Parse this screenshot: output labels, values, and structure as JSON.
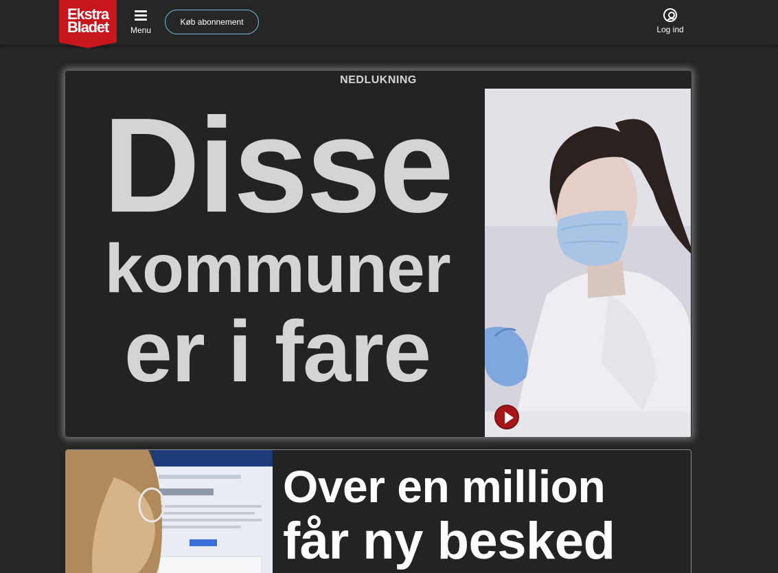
{
  "header": {
    "logo_line1": "Ekstra",
    "logo_line2": "Bladet",
    "menu_label": "Menu",
    "subscribe_label": "Køb abonnement",
    "login_label": "Log ind"
  },
  "main_story": {
    "kicker": "NEDLUKNING",
    "headline_line1": "Disse",
    "headline_line2": "kommuner",
    "headline_line3": "er i fare",
    "media": "video"
  },
  "second_story": {
    "headline_line1": "Over en million",
    "headline_line2": "får ny besked"
  },
  "colors": {
    "background": "#262626",
    "brand_red": "#c8161d",
    "subscribe_border": "#6dbfe0",
    "headline_grey": "#d4d4d4"
  },
  "icons": {
    "menu": "hamburger-icon",
    "login": "user-circle-icon",
    "video": "play-icon"
  }
}
